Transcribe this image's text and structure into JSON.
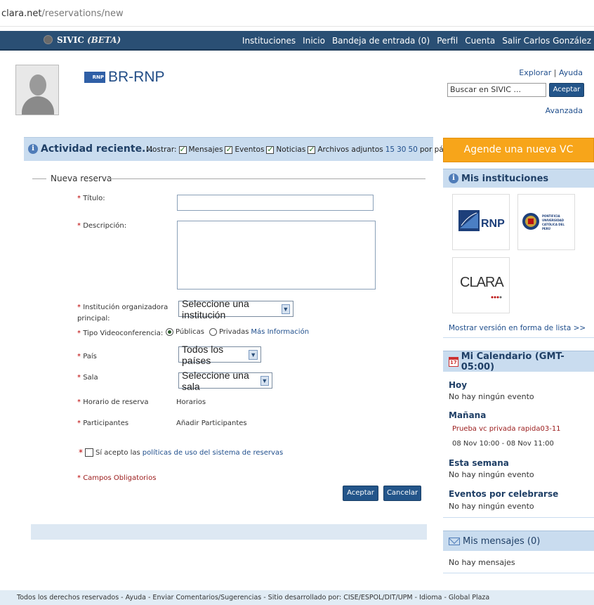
{
  "url": {
    "host": "clara.net",
    "path": "/reservations/new"
  },
  "topnav": {
    "brand": "SIVIC",
    "beta": "(BETA)",
    "links": [
      "Instituciones",
      "Inicio",
      "Bandeja de entrada (0)",
      "Perfil",
      "Cuenta",
      "Salir Carlos González"
    ]
  },
  "institution": {
    "logo_text": "RNP",
    "title": "BR-RNP"
  },
  "header_links": {
    "explore": "Explorar",
    "separator": "|",
    "help": "Ayuda"
  },
  "search": {
    "value": "Buscar en SIVIC ...",
    "button": "Aceptar",
    "advanced": "Avanzada"
  },
  "activity": {
    "title": "Actividad reciente...",
    "show_label": "Mostrar:",
    "filters": [
      {
        "label": "Mensajes",
        "checked": true
      },
      {
        "label": "Eventos",
        "checked": true
      },
      {
        "label": "Noticias",
        "checked": true
      },
      {
        "label": "Archivos adjuntos",
        "checked": true
      }
    ],
    "page_sizes": [
      "15",
      "30",
      "50"
    ],
    "per_page": "por página"
  },
  "form": {
    "legend": "Nueva reserva",
    "required_mark": "*",
    "title_label": "Título:",
    "description_label": "Descripción:",
    "institution_label_1": "Institución organizadora",
    "institution_label_2": "principal:",
    "institution_select": "Seleccione una institución",
    "vc_type_label": "Tipo Videoconferencia:",
    "vc_public": "Públicas",
    "vc_private": "Privadas",
    "more_info": "Más Información",
    "country_label": "País",
    "country_select": "Todos los países",
    "room_label": "Sala",
    "room_select": "Seleccione una sala",
    "schedule_label": "Horario de reserva",
    "schedule_link": "Horarios",
    "participants_label": "Participantes",
    "participants_link": "Añadir Participantes",
    "accept_text": "Sí acepto las",
    "policies_link": "políticas de uso del sistema de reservas",
    "mandatory": "Campos Obligatorios",
    "accept_button": "Aceptar",
    "cancel_button": "Cancelar"
  },
  "sidebar": {
    "schedule_vc": "Agende una nueva VC",
    "my_institutions": "Mis instituciones",
    "inst_tiles": [
      "RNP",
      "PONTIFICIA UNIVERSIDAD CATÓLICA DEL PERÚ",
      "CLARA"
    ],
    "list_view": "Mostrar versión en forma de lista >>",
    "calendar_title": "Mi Calendario (GMT-05:00)",
    "calendar_icon_text": "17",
    "today": "Hoy",
    "today_text": "No hay ningún evento",
    "tomorrow": "Mañana",
    "tomorrow_event": "Prueba vc privada rapida03-11",
    "tomorrow_time": "08 Nov 10:00 - 08 Nov 11:00",
    "week": "Esta semana",
    "week_text": "No hay ningún evento",
    "upcoming": "Eventos por celebrarse",
    "upcoming_text": "No hay ningún evento",
    "messages_title": "Mis mensajes (0)",
    "messages_text": "No hay mensajes"
  },
  "footer": "Todos los derechos reservados - Ayuda - Enviar Comentarios/Sugerencias - Sitio desarrollado por: CISE/ESPOL/DIT/UPM - Idioma - Global Plaza",
  "colors": {
    "nav": "#2a4f74",
    "accent": "#f7a51a",
    "panel": "#c9dcef",
    "link": "#1f4e8c"
  }
}
